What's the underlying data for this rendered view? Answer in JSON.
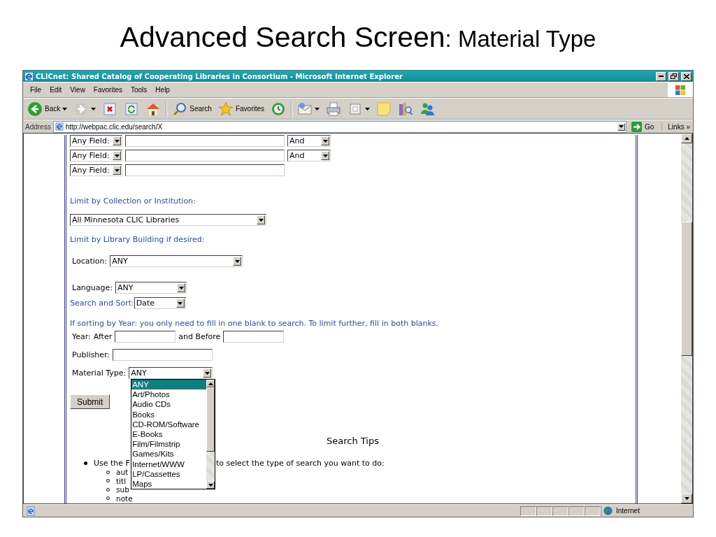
{
  "slide_title": {
    "main": "Advanced Search Screen",
    "sub": ": Material Type"
  },
  "window": {
    "title": "CLICnet: Shared Catalog of Cooperating Libraries in Consortium - Microsoft Internet Explorer",
    "menu": [
      "File",
      "Edit",
      "View",
      "Favorites",
      "Tools",
      "Help"
    ],
    "toolbar": [
      {
        "kind": "button",
        "label": "Back",
        "menu": true
      },
      {
        "kind": "button",
        "menu": true
      },
      {
        "kind": "button",
        "menu": false
      },
      {
        "kind": "button",
        "menu": false
      },
      {
        "kind": "button",
        "menu": false
      },
      {
        "kind": "separator"
      },
      {
        "kind": "button",
        "label": "Search",
        "menu": false
      },
      {
        "kind": "button",
        "label": "Favorites",
        "menu": false
      },
      {
        "kind": "button",
        "menu": false
      },
      {
        "kind": "separator"
      },
      {
        "kind": "button",
        "menu": true
      },
      {
        "kind": "button",
        "menu": false
      },
      {
        "kind": "button",
        "menu": true
      },
      {
        "kind": "button",
        "menu": false
      },
      {
        "kind": "button",
        "menu": false
      },
      {
        "kind": "button",
        "menu": false
      }
    ],
    "address": {
      "label": "Address",
      "value": "http://webpac.clic.edu/search/X",
      "go": "Go",
      "links": "Links »"
    },
    "status": {
      "zone": "Internet"
    }
  },
  "search_rows": [
    {
      "field": "Any Field:",
      "operator": "And"
    },
    {
      "field": "Any Field:",
      "operator": "And"
    },
    {
      "field": "Any Field:"
    }
  ],
  "collection": {
    "heading": "Limit by Collection or Institution:",
    "value": "All Minnesota CLIC Libraries"
  },
  "building": {
    "heading": "Limit by Library Building if desired:"
  },
  "location": {
    "label": "Location:",
    "value": "ANY"
  },
  "language": {
    "label": "Language:",
    "value": "ANY"
  },
  "sort": {
    "label": "Search and Sort:",
    "value": "Date"
  },
  "year_hint": "If sorting by Year: you only need to fill in one blank to search. To limit further, fill in both blanks.",
  "year": {
    "label": "Year:",
    "after": "After",
    "before": "and Before"
  },
  "publisher": {
    "label": "Publisher:"
  },
  "material": {
    "label": "Material Type:",
    "value": "ANY",
    "expanded": true,
    "options": [
      {
        "label": "ANY",
        "selected": true
      },
      {
        "label": "Art/Photos",
        "selected": false
      },
      {
        "label": "Audio CDs",
        "selected": false
      },
      {
        "label": "Books",
        "selected": false
      },
      {
        "label": "CD-ROM/Software",
        "selected": false
      },
      {
        "label": "E-Books",
        "selected": false
      },
      {
        "label": "Film/Filmstrip",
        "selected": false
      },
      {
        "label": "Games/Kits",
        "selected": false
      },
      {
        "label": "Internet/WWW",
        "selected": false
      },
      {
        "label": "LP/Cassettes",
        "selected": false
      },
      {
        "label": "Maps",
        "selected": false
      }
    ]
  },
  "submit": "Submit",
  "tips": {
    "heading": "Search Tips",
    "intro_start": "Use the F",
    "intro_end": "to select the type of search you want to do:",
    "items": [
      "aut",
      "titl",
      "sub",
      "note"
    ]
  }
}
